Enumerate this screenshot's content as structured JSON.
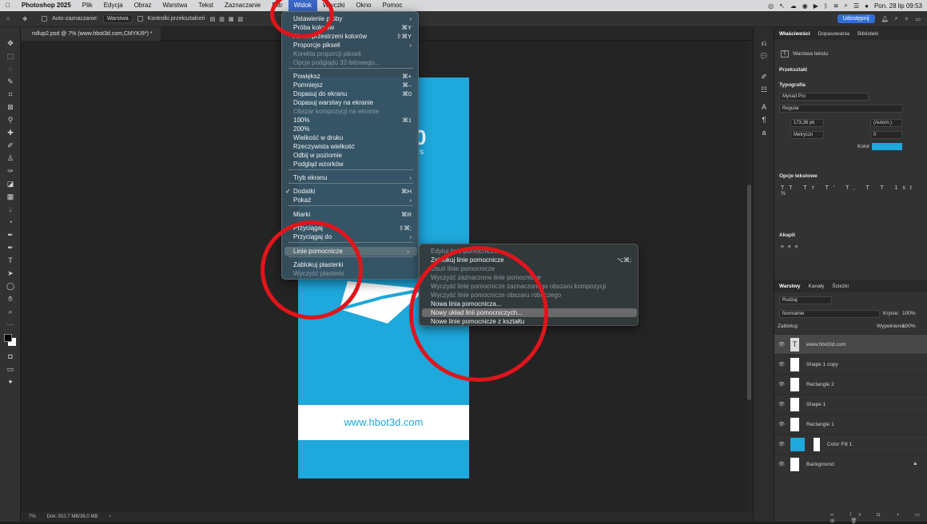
{
  "mac_menu": {
    "app": "Photoshop 2025",
    "items": [
      "Plik",
      "Edycja",
      "Obraz",
      "Warstwa",
      "Tekst",
      "Zaznaczanie",
      "Filtr",
      "Widok",
      "Wtyczki",
      "Okno",
      "Pomoc"
    ],
    "active": "Widok",
    "datetime": "Pon. 28 lip 09:53"
  },
  "options_bar": {
    "auto_select": "Auto-zaznaczanie:",
    "layer_select": "Warstwa",
    "transform": "Kontrolki przekształceń",
    "share": "Udostępnij"
  },
  "document_tab": "rollup2.psd @ 7% (www.hbot3d.com,CMYK/8*) *",
  "document": {
    "url_text": "www.hbot3d.com",
    "partial_text": "0",
    "partial_small": "s"
  },
  "status": {
    "zoom": "7%",
    "doc": "Dok: 910,7 MB/38,0 MB"
  },
  "view_menu": {
    "items": [
      {
        "label": "Ustawienie próby",
        "shortcut": "",
        "arrow": true
      },
      {
        "label": "Próba kolorów",
        "shortcut": "⌘Y"
      },
      {
        "label": "Alarm przestrzeni kolorów",
        "shortcut": "⇧⌘Y"
      },
      {
        "label": "Proporcje pikseli",
        "arrow": true
      },
      {
        "label": "Korekta proporcji pikseli",
        "disabled": true
      },
      {
        "label": "Opcje podglądu 32-bitowego...",
        "disabled": true
      },
      {
        "label": "Powiększ",
        "shortcut": "⌘+"
      },
      {
        "label": "Pomniejsz",
        "shortcut": "⌘–"
      },
      {
        "label": "Dopasuj do ekranu",
        "shortcut": "⌘0"
      },
      {
        "label": "Dopasuj warstwy na ekranie"
      },
      {
        "label": "Obszar kompozycji na ekranie",
        "disabled": true
      },
      {
        "label": "100%",
        "shortcut": "⌘1"
      },
      {
        "label": "200%"
      },
      {
        "label": "Wielkość w druku"
      },
      {
        "label": "Rzeczywista wielkość"
      },
      {
        "label": "Odbij w poziomie"
      },
      {
        "label": "Podgląd wzorków"
      },
      {
        "label": "Tryb ekranu",
        "arrow": true
      },
      {
        "label": "Dodatki",
        "shortcut": "⌘H",
        "checked": true
      },
      {
        "label": "Pokaż",
        "arrow": true
      },
      {
        "label": "Miarki",
        "shortcut": "⌘R"
      },
      {
        "label": "Przyciągaj",
        "shortcut": "⇧⌘;",
        "checked": true
      },
      {
        "label": "Przyciągaj do",
        "arrow": true
      },
      {
        "label": "Linie pomocnicze",
        "arrow": true,
        "highlight": true
      },
      {
        "label": "Zablokuj plasterki"
      },
      {
        "label": "Wyczyść plasterki",
        "disabled": true
      }
    ]
  },
  "guides_submenu": {
    "items": [
      {
        "label": "Edytuj linie pomocnicze",
        "disabled": true
      },
      {
        "label": "Zablokuj linie pomocnicze",
        "shortcut": "⌥⌘;"
      },
      {
        "label": "Usuń linie pomocnicze",
        "disabled": true
      },
      {
        "label": "Wyczyść zaznaczone linie pomocnicze",
        "disabled": true
      },
      {
        "label": "Wyczyść linie pomocnicze zaznaczonego obszaru kompozycji",
        "disabled": true
      },
      {
        "label": "Wyczyść linie pomocnicze obszaru roboczego",
        "disabled": true
      },
      {
        "label": "Nowa linia pomocnicza..."
      },
      {
        "label": "Nowy układ linii pomocniczych...",
        "highlight": true
      },
      {
        "label": "Nowe linie pomocnicze z kształtu"
      }
    ]
  },
  "properties": {
    "tabs": [
      "Właściwości",
      "Dopasowania",
      "Biblioteki"
    ],
    "layer_kind": "Warstwa tekstu",
    "transform": "Przekształć",
    "typography": "Typografia",
    "font": "Myriad Pro",
    "style": "Regular",
    "size": "173,36 pk",
    "leading": "(Autom.)",
    "kerning": "Metryczn",
    "tracking": "0",
    "color_label": "Kolor",
    "color": "#1ea8dc",
    "text_options": "Opcje tekstowe",
    "paragraph": "Akapit"
  },
  "layers": {
    "tabs": [
      "Warstwy",
      "Kanały",
      "Ścieżki"
    ],
    "filter": "Rodzaj",
    "blend": "Normalnie",
    "opacity_label": "Krycie:",
    "opacity": "100%",
    "lock_label": "Zablokuj:",
    "fill_label": "Wypełnienie:",
    "fill": "100%",
    "items": [
      "www.hbot3d.com",
      "Shape 1 copy",
      "Rectangle 2",
      "Shape 1",
      "Rectangle 1",
      "Color Fill 1",
      "Background"
    ]
  }
}
